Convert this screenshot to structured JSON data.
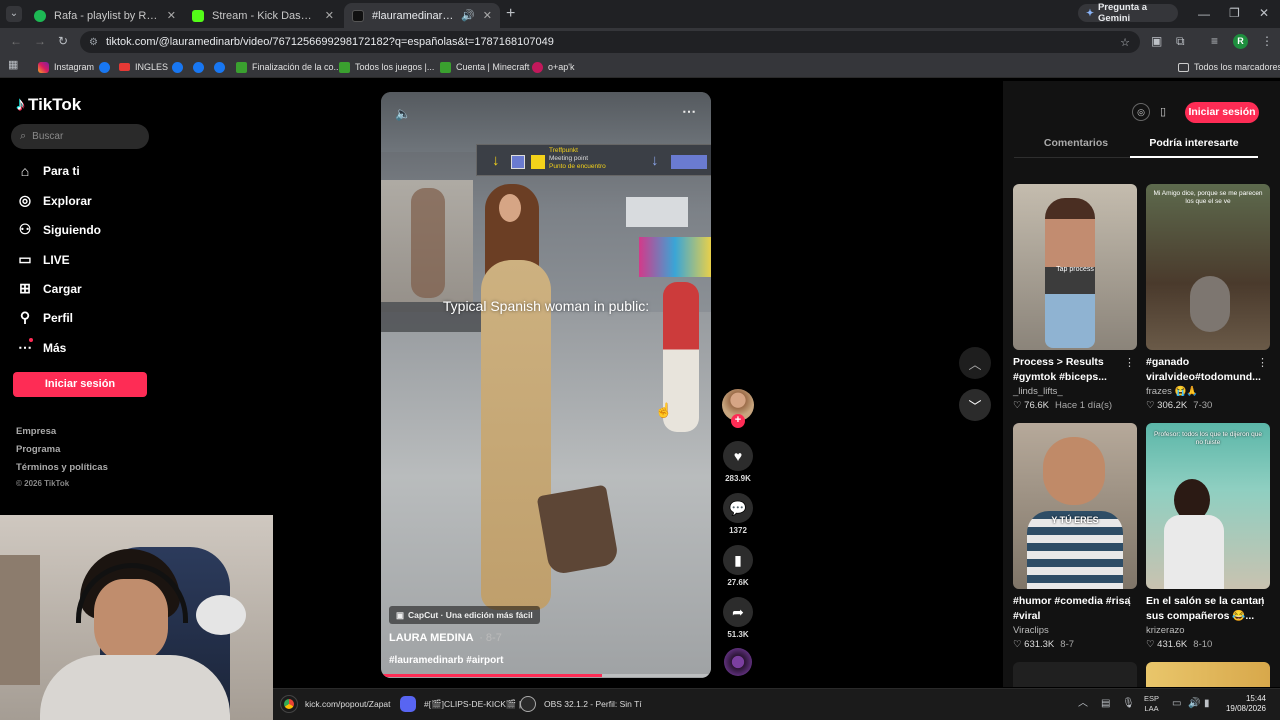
{
  "browser": {
    "tabs": [
      {
        "title": "Rafa - playlist by Rafael.xared |",
        "icon": "spotify-icon"
      },
      {
        "title": "Stream - Kick Dashboard",
        "icon": "kick-icon"
      },
      {
        "title": "#lauramedinarb #airport | T",
        "icon": "tiktok-icon"
      }
    ],
    "gemini_button": "Pregunta a Gemini",
    "url": "tiktok.com/@lauramedinarb/video/7671256699298172182?q=españolas&t=1787168107049",
    "profile_initial": "R",
    "bookmarks": [
      "Instagram",
      "INGLES",
      "Finalización de la co...",
      "Todos los juegos |...",
      "Cuenta | Minecraft",
      "o+ap'k"
    ],
    "all_bookmarks": "Todos los marcadores"
  },
  "tiktok": {
    "logo": "TikTok",
    "search_placeholder": "Buscar",
    "nav": [
      "Para ti",
      "Explorar",
      "Siguiendo",
      "LIVE",
      "Cargar",
      "Perfil",
      "Más"
    ],
    "login_button": "Iniciar sesión",
    "footer": [
      "Empresa",
      "Programa",
      "Términos y políticas",
      "© 2026 TikTok"
    ]
  },
  "video": {
    "overlay_sign_1": "Treffpunkt",
    "overlay_sign_2": "Meeting point",
    "overlay_sign_3": "Punto de encuentro",
    "caption": "Typical Spanish woman in public:",
    "capcut": "CapCut · Una edición más fácil",
    "author": "LAURA MEDINA",
    "date": "· 8-7",
    "hashtags": "#lauramedinarb #airport",
    "progress": 0.67
  },
  "actions": {
    "likes": "283.9K",
    "comments": "1372",
    "saves": "27.6K",
    "shares": "51.3K"
  },
  "right_panel": {
    "login_button": "Iniciar sesión",
    "tabs": [
      "Comentarios",
      "Podría interesarte"
    ],
    "active_tab": "Podría interesarte",
    "cards": [
      {
        "title": "Process > Results #gymtok #biceps...",
        "author": "_linds_lifts_",
        "stats": "76.6K",
        "date": "Hace 1 día(s)",
        "overlay": "Tap process"
      },
      {
        "title": "#ganado viralvideo#todomund...",
        "author": "frazes 😭🙏",
        "stats": "306.2K",
        "date": "7-30",
        "overlay": "Mi Amigo dice, porque se me parecen los que el se ve"
      },
      {
        "title": "#humor #comedia #risa #viral",
        "author": "Viraclips",
        "stats": "631.3K",
        "date": "8-7",
        "overlay": "Y TÚ ERES"
      },
      {
        "title": "En el salón se la cantan sus compañeros 😂...",
        "author": "krizerazo",
        "stats": "431.6K",
        "date": "8-10",
        "overlay": "Profesor: todos los que te dijeron que no fuiste"
      }
    ]
  },
  "taskbar": {
    "items": [
      "kick.com/popout/Zapat",
      "#[🎬]CLIPS-DE-KICK🎬 |",
      "OBS 32.1.2 - Perfil: Sin Tí"
    ],
    "lang": "ESP",
    "lang_sub": "LAA",
    "time": "15:44",
    "date": "19/08/2026"
  }
}
